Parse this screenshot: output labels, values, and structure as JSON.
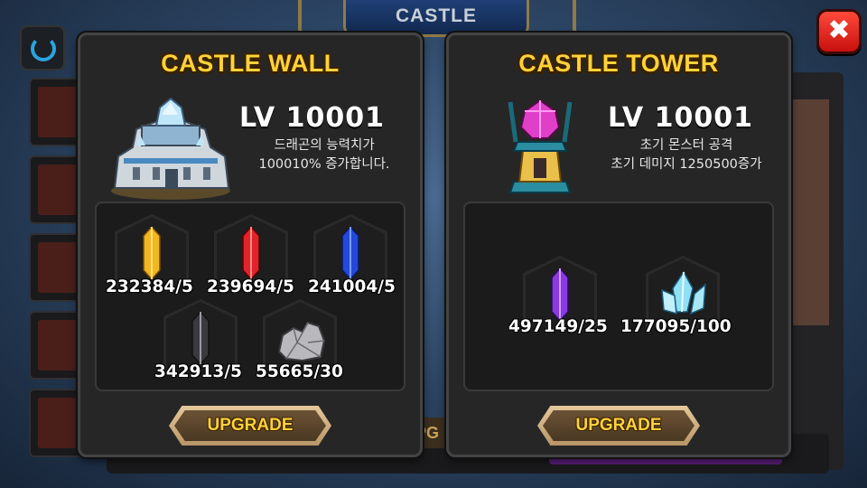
{
  "background": {
    "screen_title": "CASTLE"
  },
  "close_button": {
    "glyph": "✖",
    "color": "#e8231b"
  },
  "wall_panel": {
    "title": "CASTLE WALL",
    "level": "LV 10001",
    "description_line1": "드래곤의 능력치가",
    "description_line2": "100010% 증가합니다.",
    "materials": [
      {
        "icon": "yellow-crystal-icon",
        "count": "232384/5",
        "color": "#f2b822"
      },
      {
        "icon": "red-crystal-icon",
        "count": "239694/5",
        "color": "#e0242b"
      },
      {
        "icon": "blue-crystal-icon",
        "count": "241004/5",
        "color": "#2448d8"
      },
      {
        "icon": "black-crystal-icon",
        "count": "342913/5",
        "color": "#4a4a4e"
      },
      {
        "icon": "silver-ore-icon",
        "count": "55665/30",
        "color": "#b9b9bd"
      }
    ],
    "upgrade_label": "UPGRADE"
  },
  "tower_panel": {
    "title": "CASTLE TOWER",
    "level": "LV 10001",
    "description_line1": "초기 몬스터 공격",
    "description_line2": "초기 데미지 1250500증가",
    "materials": [
      {
        "icon": "purple-crystal-icon",
        "count": "497149/25",
        "color": "#8a3ae0"
      },
      {
        "icon": "ice-crystal-icon",
        "count": "177095/100",
        "color": "#8fe0f5"
      }
    ],
    "upgrade_label": "UPGRADE"
  },
  "accent": {
    "title_gold": "#ffd23a",
    "panel_bg": "#262626"
  }
}
